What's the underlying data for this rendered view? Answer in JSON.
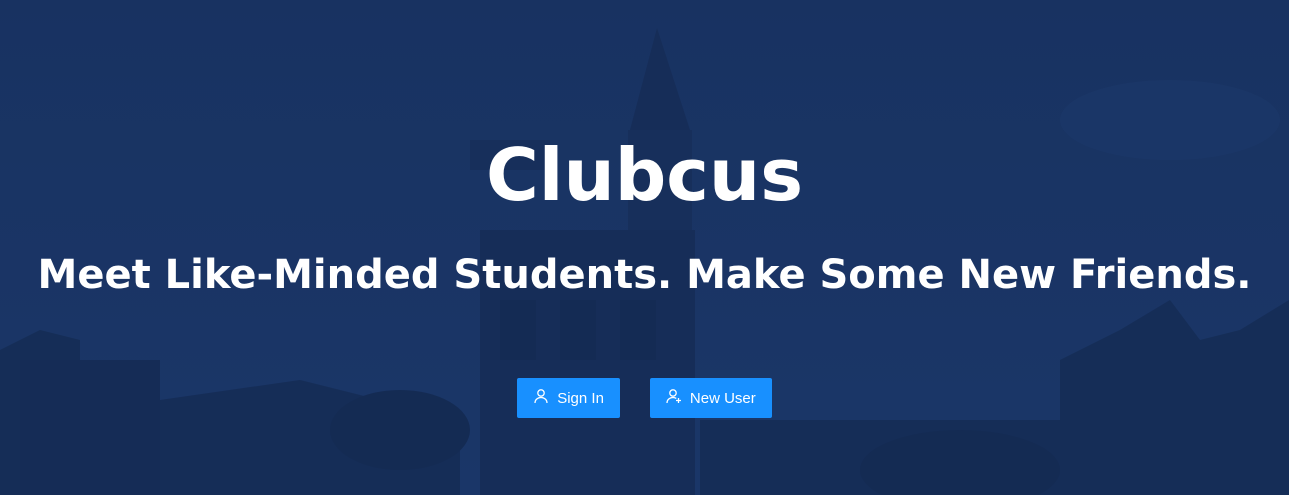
{
  "hero": {
    "title": "Clubcus",
    "subtitle": "Meet Like-Minded Students. Make Some New Friends."
  },
  "actions": {
    "sign_in_label": "Sign In",
    "new_user_label": "New User"
  },
  "icons": {
    "sign_in": "user-icon",
    "new_user": "user-add-icon"
  },
  "colors": {
    "accent": "#1890ff",
    "overlay": "#1a3462"
  }
}
